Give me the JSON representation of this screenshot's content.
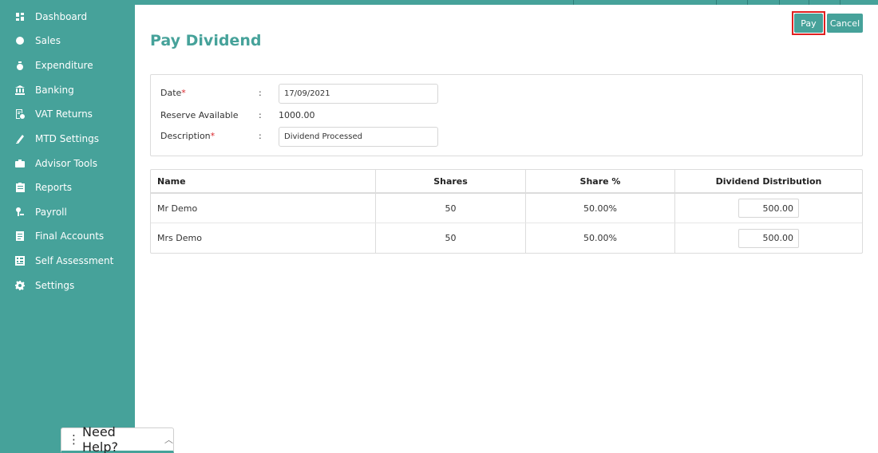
{
  "sidebar": {
    "items": [
      {
        "label": "Dashboard",
        "icon": "dashboard-icon"
      },
      {
        "label": "Sales",
        "icon": "sales-icon"
      },
      {
        "label": "Expenditure",
        "icon": "money-bag-icon"
      },
      {
        "label": "Banking",
        "icon": "bank-icon"
      },
      {
        "label": "VAT Returns",
        "icon": "vat-returns-icon"
      },
      {
        "label": "MTD Settings",
        "icon": "mtd-settings-icon"
      },
      {
        "label": "Advisor Tools",
        "icon": "briefcase-icon"
      },
      {
        "label": "Reports",
        "icon": "reports-icon"
      },
      {
        "label": "Payroll",
        "icon": "payroll-icon"
      },
      {
        "label": "Final Accounts",
        "icon": "final-accounts-icon"
      },
      {
        "label": "Self Assessment",
        "icon": "self-assessment-icon"
      },
      {
        "label": "Settings",
        "icon": "gear-icon"
      }
    ]
  },
  "page": {
    "title": "Pay Dividend"
  },
  "actions": {
    "pay_label": "Pay",
    "cancel_label": "Cancel"
  },
  "form": {
    "date_label": "Date",
    "date_value": "17/09/2021",
    "reserve_label": "Reserve Available",
    "reserve_value": "1000.00",
    "description_label": "Description",
    "description_value": "Dividend Processed",
    "required_marker": "*",
    "colon": ":"
  },
  "table": {
    "headers": [
      "Name",
      "Shares",
      "Share %",
      "Dividend Distribution"
    ],
    "rows": [
      {
        "name": "Mr Demo",
        "shares": "50",
        "share_pct": "50.00%",
        "dividend": "500.00"
      },
      {
        "name": "Mrs Demo",
        "shares": "50",
        "share_pct": "50.00%",
        "dividend": "500.00"
      }
    ]
  },
  "help": {
    "label": "Need Help?"
  },
  "colors": {
    "accent": "#46a29a",
    "required": "#d9262c",
    "highlight": "#e02020"
  }
}
